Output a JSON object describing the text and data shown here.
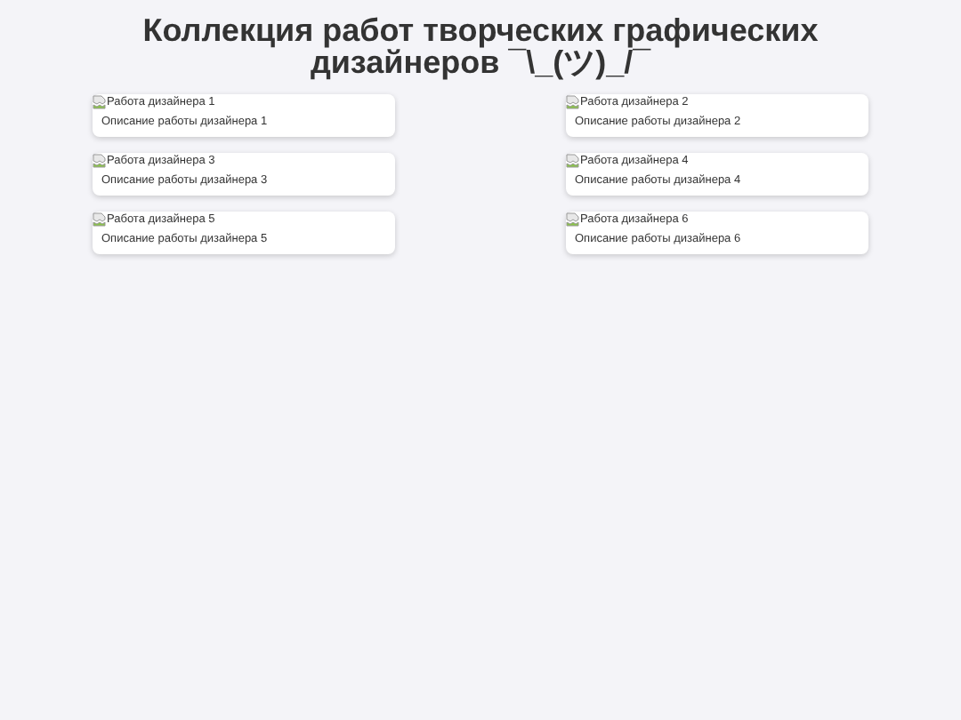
{
  "title": "Коллекция работ творческих графических дизайнеров ¯\\_(ツ)_/¯",
  "works": [
    {
      "image_alt": "Работа дизайнера 1",
      "description": "Описание работы дизайнера 1"
    },
    {
      "image_alt": "Работа дизайнера 2",
      "description": "Описание работы дизайнера 2"
    },
    {
      "image_alt": "Работа дизайнера 3",
      "description": "Описание работы дизайнера 3"
    },
    {
      "image_alt": "Работа дизайнера 4",
      "description": "Описание работы дизайнера 4"
    },
    {
      "image_alt": "Работа дизайнера 5",
      "description": "Описание работы дизайнера 5"
    },
    {
      "image_alt": "Работа дизайнера 6",
      "description": "Описание работы дизайнера 6"
    }
  ]
}
